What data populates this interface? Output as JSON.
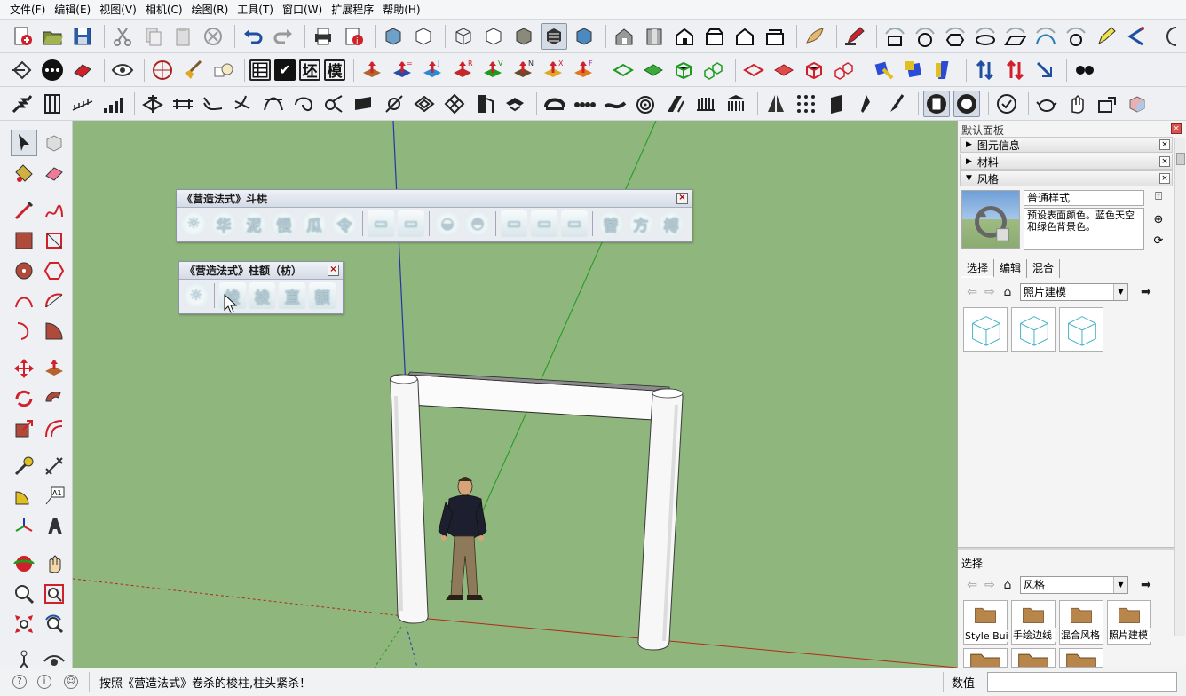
{
  "menu": [
    "文件(F)",
    "编辑(E)",
    "视图(V)",
    "相机(C)",
    "绘图(R)",
    "工具(T)",
    "窗口(W)",
    "扩展程序",
    "帮助(H)"
  ],
  "toolbar": {
    "text_buttons": [
      "坯",
      "模"
    ],
    "axis_labels": [
      "J",
      "R",
      "V",
      "N",
      "X",
      "F"
    ]
  },
  "float_dougong": {
    "title": "《营造法式》斗栱",
    "icons": [
      "华",
      "泥",
      "慢",
      "瓜",
      "令",
      "替",
      "方",
      "榑"
    ]
  },
  "float_zhu": {
    "title": "《营造法式》柱额（枋）",
    "icons": [
      "梭",
      "梭",
      "直",
      "额"
    ]
  },
  "right_panel": {
    "title": "默认面板",
    "sections": [
      {
        "label": "图元信息",
        "arrow": "▶"
      },
      {
        "label": "材料",
        "arrow": "▶"
      },
      {
        "label": "风格",
        "arrow": "▼"
      }
    ],
    "style_name": "普通样式",
    "style_desc": "预设表面颜色。蓝色天空和绿色背景色。",
    "tabs": [
      "选择",
      "编辑",
      "混合"
    ],
    "collection_1": "照片建模",
    "lower_title": "选择",
    "collection_2": "风格",
    "lower_thumbs": [
      "Style Buil",
      "手绘边线",
      "混合风格",
      "照片建模"
    ]
  },
  "status": {
    "message": "按照《营造法式》卷杀的梭柱,柱头紧杀！",
    "measure_label": "数值",
    "measure_value": ""
  },
  "colors": {
    "viewport_bg": "#8fb67c",
    "axis_red": "#b22a1a",
    "axis_green": "#1f9a1f",
    "axis_blue": "#2136a8"
  }
}
